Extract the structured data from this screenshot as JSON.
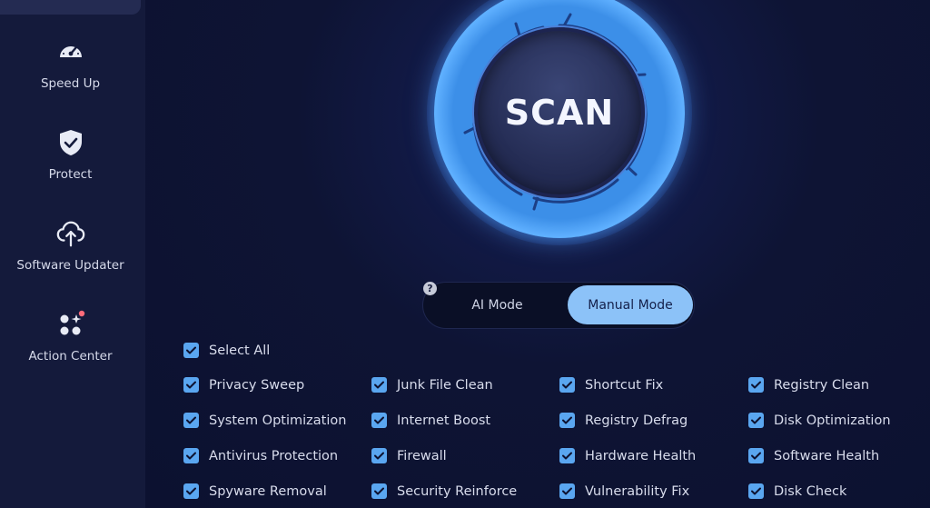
{
  "sidebar": {
    "items": [
      {
        "label": "Speed Up",
        "icon": "speedometer-icon"
      },
      {
        "label": "Protect",
        "icon": "shield-check-icon"
      },
      {
        "label": "Software Updater",
        "icon": "cloud-upload-icon"
      },
      {
        "label": "Action Center",
        "icon": "apps-grid-icon"
      }
    ]
  },
  "scan": {
    "label": "SCAN"
  },
  "mode": {
    "help": "?",
    "ai_label": "AI Mode",
    "manual_label": "Manual Mode",
    "selected": "Manual Mode"
  },
  "checklist": {
    "select_all": "Select All",
    "columns": [
      [
        "Privacy Sweep",
        "System Optimization",
        "Antivirus Protection",
        "Spyware Removal"
      ],
      [
        "Junk File Clean",
        "Internet Boost",
        "Firewall",
        "Security Reinforce"
      ],
      [
        "Shortcut Fix",
        "Registry Defrag",
        "Hardware Health",
        "Vulnerability Fix"
      ],
      [
        "Registry Clean",
        "Disk Optimization",
        "Software Health",
        "Disk Check"
      ]
    ]
  },
  "colors": {
    "accent": "#5aa6f0",
    "toggle_active": "#8cc2f8",
    "badge": "#ff6b7a"
  }
}
